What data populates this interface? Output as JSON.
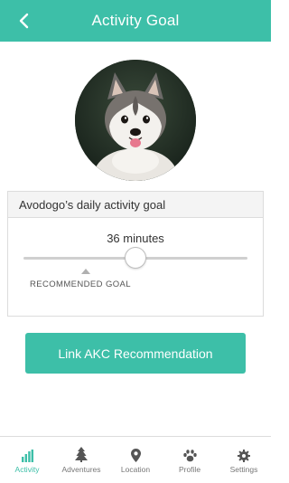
{
  "header": {
    "title": "Activity Goal",
    "back_icon": "chevron-left-icon"
  },
  "avatar": {
    "alt": "Husky puppy avatar"
  },
  "goal_card": {
    "title": "Avodogo’s daily activity goal",
    "minutes_label": "36 minutes",
    "slider_value_fraction": 0.5,
    "recommended_fraction": 0.28,
    "recommended_label": "RECOMMENDED GOAL"
  },
  "akc_button": {
    "label": "Link AKC Recommendation"
  },
  "bottom_nav": {
    "items": [
      {
        "label": "Activity",
        "icon": "bar-chart-icon",
        "active": true
      },
      {
        "label": "Adventures",
        "icon": "tree-icon",
        "active": false
      },
      {
        "label": "Location",
        "icon": "location-pin-icon",
        "active": false
      },
      {
        "label": "Profile",
        "icon": "paw-icon",
        "active": false
      },
      {
        "label": "Settings",
        "icon": "gear-icon",
        "active": false
      }
    ]
  },
  "colors": {
    "accent": "#3dbfa8",
    "inactive_icon": "#555555",
    "inactive_label": "#777777"
  }
}
